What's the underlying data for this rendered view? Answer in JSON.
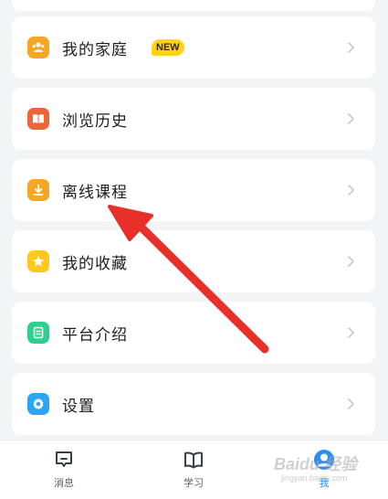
{
  "menu": {
    "items": [
      {
        "label": "我的家庭",
        "icon": "family-icon",
        "color": "#f5a623",
        "badge": "NEW"
      },
      {
        "label": "浏览历史",
        "icon": "book-icon",
        "color": "#f0643c"
      },
      {
        "label": "离线课程",
        "icon": "download-icon",
        "color": "#f5a623"
      },
      {
        "label": "我的收藏",
        "icon": "star-icon",
        "color": "#ffc81e"
      },
      {
        "label": "平台介绍",
        "icon": "document-icon",
        "color": "#2ecf8f"
      },
      {
        "label": "设置",
        "icon": "gear-icon",
        "color": "#2aa6f5"
      }
    ]
  },
  "tabbar": {
    "tabs": [
      {
        "label": "消息",
        "icon": "message-icon"
      },
      {
        "label": "学习",
        "icon": "open-book-icon"
      },
      {
        "label": "我",
        "icon": "profile-icon",
        "active": true
      }
    ]
  },
  "annotation": {
    "color": "#e8302a"
  },
  "watermark": {
    "text": "Baidu 经验",
    "sub": "jingyan.baidu.com"
  }
}
